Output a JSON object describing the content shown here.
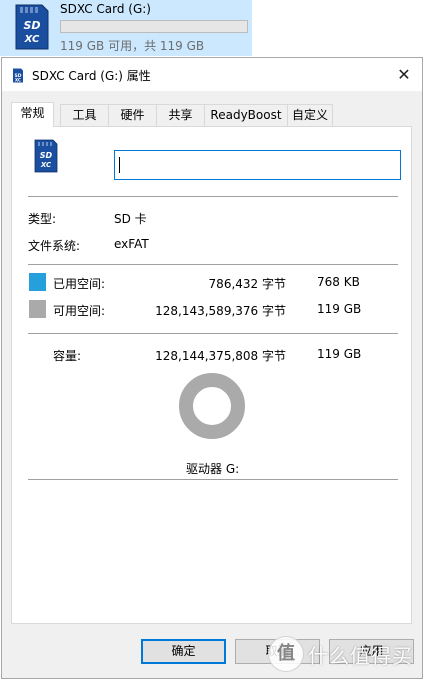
{
  "explorer_tile": {
    "name": "SDXC Card (G:)",
    "size_text": "119 GB 可用，共 119 GB",
    "used_fraction": 0.0
  },
  "dialog": {
    "title": "SDXC Card (G:) 属性",
    "close_glyph": "✕",
    "tabs": [
      {
        "label": "常规",
        "active": true
      },
      {
        "label": "工具",
        "active": false
      },
      {
        "label": "硬件",
        "active": false
      },
      {
        "label": "共享",
        "active": false
      },
      {
        "label": "ReadyBoost",
        "active": false
      },
      {
        "label": "自定义",
        "active": false
      }
    ],
    "volume_name_value": "",
    "info": {
      "type_label": "类型:",
      "type_value": "SD 卡",
      "fs_label": "文件系统:",
      "fs_value": "exFAT"
    },
    "space": {
      "used_label": "已用空间:",
      "used_bytes": "786,432 字节",
      "used_size": "768 KB",
      "free_label": "可用空间:",
      "free_bytes": "128,143,589,376 字节",
      "free_size": "119 GB",
      "capacity_label": "容量:",
      "capacity_bytes": "128,144,375,808 字节",
      "capacity_size": "119 GB"
    },
    "drive_label": "驱动器 G:",
    "buttons": {
      "ok": "确定",
      "cancel": "取消",
      "apply": "应用"
    }
  },
  "colors": {
    "used": "#26a0da",
    "free": "#aaaaaa",
    "accent": "#0078d7",
    "card_blue": "#1a4fa0"
  },
  "watermark": {
    "logo_glyph": "值",
    "text": "什么值得买"
  }
}
